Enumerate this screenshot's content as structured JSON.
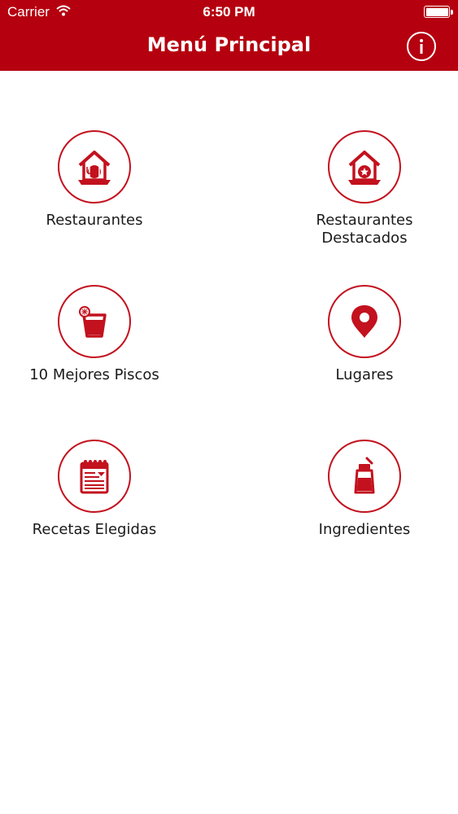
{
  "status_bar": {
    "carrier": "Carrier",
    "time": "6:50 PM"
  },
  "nav": {
    "title": "Menú Principal",
    "info_icon": "info-icon"
  },
  "colors": {
    "brand_red": "#b5000f",
    "icon_red": "#c3111e"
  },
  "menu": [
    {
      "label": "Restaurantes",
      "icon": "restaurant-icon"
    },
    {
      "label_line1": "Restaurantes",
      "label_line2": "Destacados",
      "icon": "featured-restaurant-icon"
    },
    {
      "label": "10 Mejores Piscos",
      "icon": "pisco-glass-icon"
    },
    {
      "label": "Lugares",
      "icon": "location-pin-icon"
    },
    {
      "label": "Recetas Elegidas",
      "icon": "recipe-book-icon"
    },
    {
      "label": "Ingredientes",
      "icon": "ingredient-bottle-icon"
    }
  ]
}
